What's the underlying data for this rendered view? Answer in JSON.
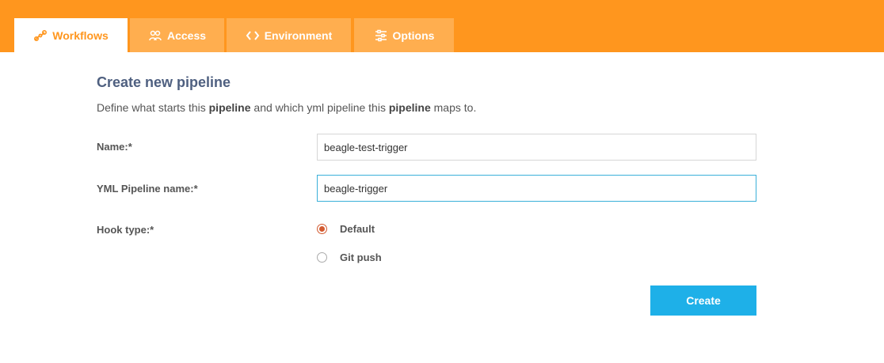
{
  "tabs": [
    {
      "label": "Workflows",
      "icon": "workflow-icon",
      "active": true
    },
    {
      "label": "Access",
      "icon": "access-icon",
      "active": false
    },
    {
      "label": "Environment",
      "icon": "code-icon",
      "active": false
    },
    {
      "label": "Options",
      "icon": "sliders-icon",
      "active": false
    }
  ],
  "form": {
    "title": "Create new pipeline",
    "description": {
      "part1": "Define what starts this ",
      "bold1": "pipeline",
      "part2": " and which yml pipeline this ",
      "bold2": "pipeline",
      "part3": " maps to."
    },
    "name_label": "Name:*",
    "name_value": "beagle-test-trigger",
    "yml_label": "YML Pipeline name:*",
    "yml_value": "beagle-trigger",
    "hook_label": "Hook type:*",
    "hook_options": [
      {
        "label": "Default",
        "checked": true
      },
      {
        "label": "Git push",
        "checked": false
      }
    ],
    "create_label": "Create"
  },
  "colors": {
    "accent": "#ff961e",
    "tab_inactive": "#ffae4f",
    "button": "#1eb0e8",
    "title": "#4f6080"
  }
}
